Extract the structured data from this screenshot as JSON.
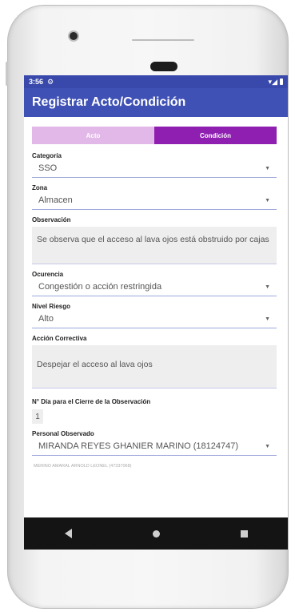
{
  "status": {
    "time": "3:56",
    "gear_icon": "⚙",
    "signal_icons": "▾◢"
  },
  "appbar": {
    "title": "Registrar Acto/Condición"
  },
  "tabs": [
    {
      "label": "Acto",
      "selected": false
    },
    {
      "label": "Condición",
      "selected": true
    }
  ],
  "form": {
    "categoria": {
      "label": "Categoría",
      "value": "SSO"
    },
    "zona": {
      "label": "Zona",
      "value": "Almacen"
    },
    "observacion": {
      "label": "Observación",
      "value": "Se observa que el acceso al lava ojos está obstruido por cajas"
    },
    "ocurencia": {
      "label": "Ocurencia",
      "value": "Congestión o acción restringida"
    },
    "nivel_riesgo": {
      "label": "Nivel Riesgo",
      "value": "Alto"
    },
    "accion_correctiva": {
      "label": "Acción Correctiva",
      "value": "Despejar el acceso al lava ojos"
    },
    "dias_cierre": {
      "label": "N° Día para el Cierre de la Observación",
      "value": "1"
    },
    "personal_observado": {
      "label": "Personal Observado",
      "value": "MIRANDA REYES GHANIER MARINO (18124747)"
    },
    "next_item": "MERINO AMARAL ARNOLD LEONEL (47337068)"
  },
  "colors": {
    "primary": "#3f51b5",
    "accent": "#8e1fb0",
    "tab_inactive": "#e2b8e8"
  }
}
